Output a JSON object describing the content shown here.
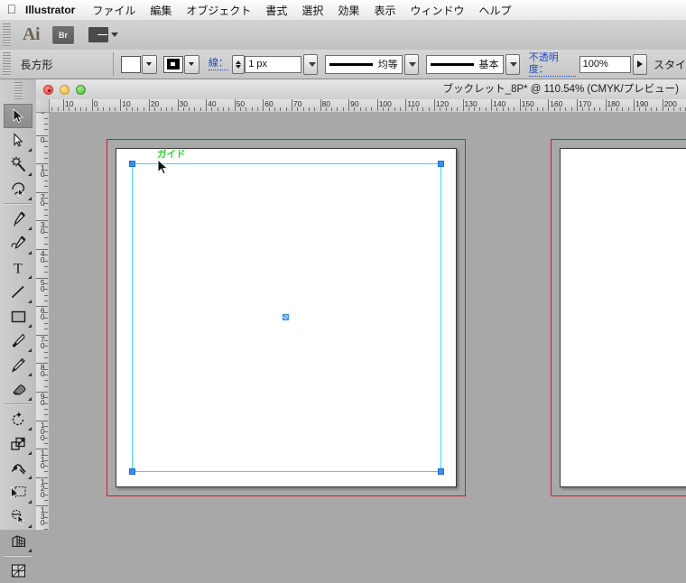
{
  "menubar": {
    "apple_icon": "apple-logo-icon",
    "app_name": "Illustrator",
    "items": [
      {
        "label": "ファイル"
      },
      {
        "label": "編集"
      },
      {
        "label": "オブジェクト"
      },
      {
        "label": "書式"
      },
      {
        "label": "選択"
      },
      {
        "label": "効果"
      },
      {
        "label": "表示"
      },
      {
        "label": "ウィンドウ"
      },
      {
        "label": "ヘルプ"
      }
    ]
  },
  "app_toolbar": {
    "logo": "Ai",
    "bridge_label": "Br",
    "arrange_icon": "arrange-documents-icon"
  },
  "control_bar": {
    "object_type": "長方形",
    "fill_label": "fill-swatch",
    "stroke_swatch_label": "stroke-swatch",
    "stroke_label": "線：",
    "stroke_weight": "1 px",
    "variable_width_profile": "均等",
    "brush_definition": "基本",
    "opacity_label": "不透明度：",
    "opacity_value": "100%",
    "style_label": "スタイ"
  },
  "tools": [
    {
      "name": "selection-tool",
      "active": true
    },
    {
      "name": "direct-selection-tool",
      "active": false
    },
    {
      "name": "magic-wand-tool",
      "active": false
    },
    {
      "name": "lasso-tool",
      "active": false
    },
    {
      "name": "pen-tool",
      "active": false
    },
    {
      "name": "add-anchor-point-tool",
      "active": false
    },
    {
      "name": "type-tool",
      "active": false
    },
    {
      "name": "line-segment-tool",
      "active": false
    },
    {
      "name": "rectangle-tool",
      "active": false
    },
    {
      "name": "paintbrush-tool",
      "active": false
    },
    {
      "name": "pencil-tool",
      "active": false
    },
    {
      "name": "eraser-tool",
      "active": false
    },
    {
      "name": "rotate-tool",
      "active": false
    },
    {
      "name": "scale-tool",
      "active": false
    },
    {
      "name": "width-tool",
      "active": false
    },
    {
      "name": "free-transform-tool",
      "active": false
    },
    {
      "name": "shape-builder-tool",
      "active": false
    },
    {
      "name": "perspective-grid-tool",
      "active": false
    },
    {
      "name": "mesh-tool",
      "active": false
    }
  ],
  "document": {
    "title": "ブックレット_8P* @ 110.54% (CMYK/プレビュー)",
    "zoom": "110.54%",
    "color_mode": "CMYK/プレビュー",
    "window_buttons": [
      "close-button",
      "minimize-button",
      "zoom-button"
    ]
  },
  "rulers": {
    "horizontal_ticks": [
      "20",
      "10",
      "0",
      "10",
      "20",
      "30",
      "40",
      "50",
      "60",
      "70",
      "80",
      "90",
      "100",
      "110",
      "120",
      "130",
      "140",
      "150",
      "160",
      "170",
      "180",
      "190",
      "200"
    ],
    "vertical_ticks": [
      "0",
      "0",
      "10",
      "20",
      "30",
      "40",
      "50",
      "60",
      "70",
      "80",
      "90",
      "100",
      "110",
      "120",
      "130"
    ],
    "unit": "px"
  },
  "canvas": {
    "guide_label": "ガイド",
    "guide_color": "#37d6f0",
    "bleed_color": "#e8112d",
    "anchor_color": "#3b8ff0",
    "background_color": "#a8a8a8",
    "artboard_count": 2
  }
}
